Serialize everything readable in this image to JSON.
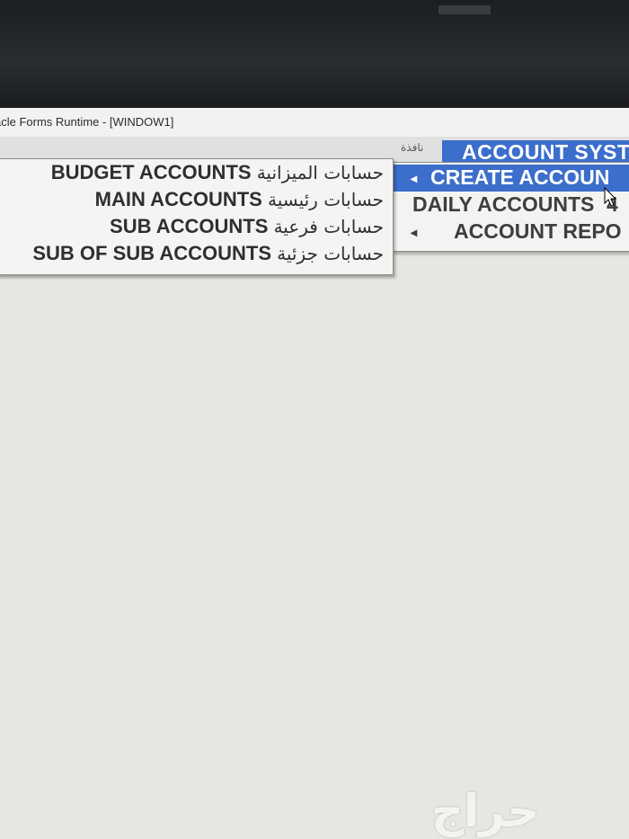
{
  "window": {
    "title": "acle Forms Runtime - [WINDOW1]"
  },
  "menubar": {
    "arabic_window": "نافذة",
    "account_system": "ACCOUNT SYST"
  },
  "dropdown1": {
    "items": [
      {
        "label": "CREATE ACCOUN",
        "arrow": "◂",
        "extra": ""
      },
      {
        "label": "DAILY ACCOUNTS",
        "arrow": "",
        "extra": "4"
      },
      {
        "label": "ACCOUNT REPO",
        "arrow": "◂",
        "extra": ""
      }
    ]
  },
  "submenu": {
    "items": [
      {
        "label": "BUDGET ACCOUNTS",
        "arabic": "حسابات الميزانية"
      },
      {
        "label": "MAIN ACCOUNTS",
        "arabic": "حسابات رئيسية"
      },
      {
        "label": "SUB ACCOUNTS",
        "arabic": "حسابات فرعية"
      },
      {
        "label": "SUB OF SUB ACCOUNTS",
        "arabic": "حسابات جزئية"
      }
    ]
  },
  "watermark": "حراج",
  "colors": {
    "selection": "#3c6ecc",
    "menu_bg": "#f3f3f1",
    "workspace_bg": "#e7e6e1"
  }
}
